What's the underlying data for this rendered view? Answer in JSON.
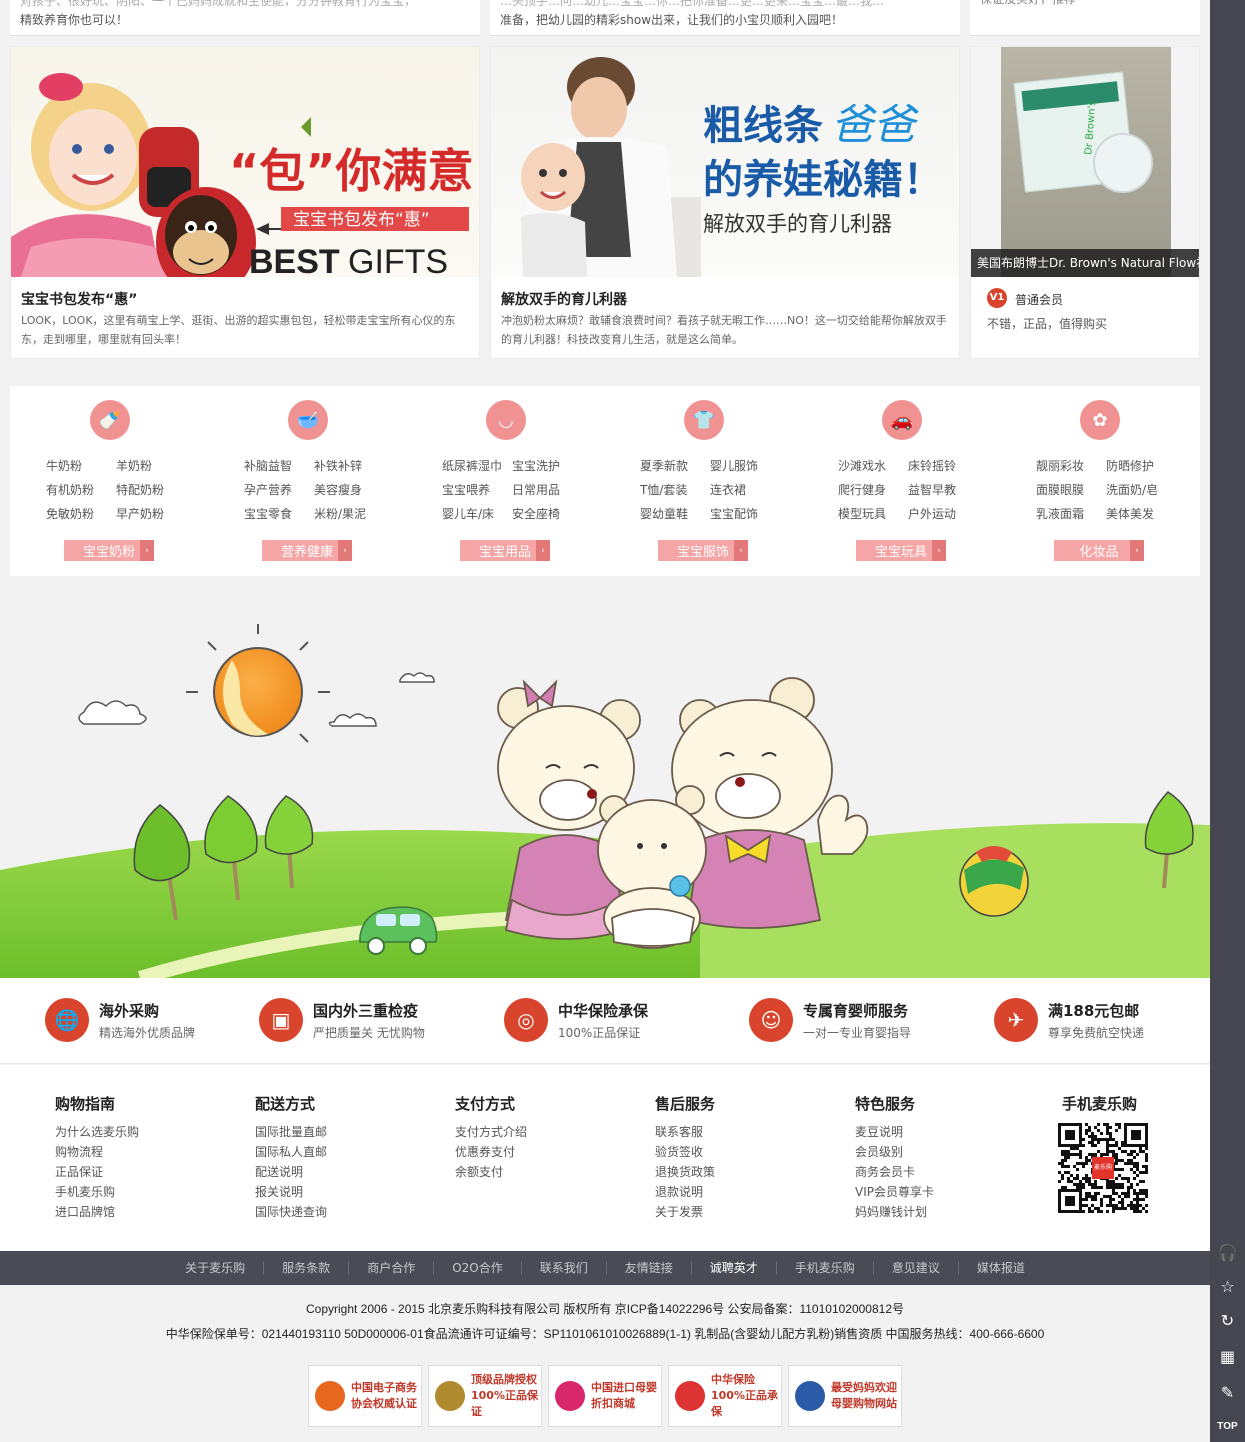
{
  "top_strip": {
    "left_text_line1": "对孩子、很好玩、阴阳、一个已妈妈成就和生使能，分分钟教育行为宝宝，",
    "left_text_line2": "精致养育你也可以！",
    "mid_text_line1": "…头顶手…问…幼儿…宝宝…你…把你准备…更…更来…宝宝…最…我…",
    "mid_text_line2": "准备，把幼儿园的精彩show出来，让我们的小宝贝顺利入园吧！",
    "right_text": "保证没买好，推荐"
  },
  "articles": [
    {
      "title": "宝宝书包发布“惠”",
      "desc": "LOOK，LOOK，这里有萌宝上学、逛街、出游的超实惠包包，轻松带走宝宝所有心仪的东东，走到哪里，哪里就有回头率！",
      "banner_big": "“包”你满意",
      "banner_tag": "宝宝书包发布“惠”",
      "banner_best": "BEST",
      "banner_gifts": "GIFTS"
    },
    {
      "title": "解放双手的育儿利器",
      "desc": "冲泡奶粉太麻烦？敢辅食浪费时间？看孩子就无暇工作……NO！这一切交给能帮你解放双手的育儿利器！科技改变育儿生活，就是这么简单。",
      "banner_l1a": "粗线条",
      "banner_l1b": "爸爸",
      "banner_l2": "的养娃秘籍！",
      "banner_sub": "解放双手的育儿利器"
    }
  ],
  "review": {
    "caption": "美国布朗博士Dr. Brown's Natural Flow初",
    "level_badge": "V1",
    "member": "普通会员",
    "comment": "不错，正品，值得购买",
    "product_box_text": "Dr Brown's"
  },
  "categories": [
    {
      "icon": "bottle-icon",
      "glyph": "🍼",
      "links": [
        "牛奶粉",
        "羊奶粉",
        "有机奶粉",
        "特配奶粉",
        "免敏奶粉",
        "早产奶粉"
      ],
      "button": "宝宝奶粉"
    },
    {
      "icon": "bowl-icon",
      "glyph": "🥣",
      "links": [
        "补脑益智",
        "补铁补锌",
        "孕产营养",
        "美容瘦身",
        "宝宝零食",
        "米粉/果泥"
      ],
      "button": "营养健康"
    },
    {
      "icon": "diaper-icon",
      "glyph": "◡",
      "links": [
        "纸尿裤湿巾",
        "宝宝洗护",
        "宝宝喂养",
        "日常用品",
        "婴儿车/床",
        "安全座椅"
      ],
      "button": "宝宝用品"
    },
    {
      "icon": "baby-clothes-icon",
      "glyph": "👕",
      "links": [
        "夏季新款",
        "婴儿服饰",
        "T恤/套装",
        "连衣裙",
        "婴幼童鞋",
        "宝宝配饰"
      ],
      "button": "宝宝服饰"
    },
    {
      "icon": "toy-car-icon",
      "glyph": "🚗",
      "links": [
        "沙滩戏水",
        "床铃摇铃",
        "爬行健身",
        "益智早教",
        "模型玩具",
        "户外运动"
      ],
      "button": "宝宝玩具"
    },
    {
      "icon": "cosmetics-icon",
      "glyph": "✿",
      "links": [
        "靓丽彩妆",
        "防晒修护",
        "面膜眼膜",
        "洗面奶/皂",
        "乳液面霜",
        "美体美发"
      ],
      "button": "化妆品"
    }
  ],
  "category_arrow": "›",
  "services": [
    {
      "icon": "globe-icon",
      "glyph": "🌐",
      "title": "海外采购",
      "desc": "精选海外优质品牌"
    },
    {
      "icon": "inspection-icon",
      "glyph": "▣",
      "title": "国内外三重检疫",
      "desc": "严把质量关 无忧购物"
    },
    {
      "icon": "insurance-icon",
      "glyph": "◎",
      "title": "中华保险承保",
      "desc": "100%正品保证"
    },
    {
      "icon": "consultant-icon",
      "glyph": "☺",
      "title": "专属育婴师服务",
      "desc": "一对一专业育婴指导"
    },
    {
      "icon": "airplane-icon",
      "glyph": "✈",
      "title": "满188元包邮",
      "desc": "尊享免费航空快递"
    }
  ],
  "footer_columns": [
    {
      "title": "购物指南",
      "links": [
        "为什么选麦乐购",
        "购物流程",
        "正品保证",
        "手机麦乐购",
        "进口品牌馆"
      ]
    },
    {
      "title": "配送方式",
      "links": [
        "国际批量直邮",
        "国际私人直邮",
        "配送说明",
        "报关说明",
        "国际快递查询"
      ]
    },
    {
      "title": "支付方式",
      "links": [
        "支付方式介绍",
        "优惠券支付",
        "余额支付"
      ]
    },
    {
      "title": "售后服务",
      "links": [
        "联系客服",
        "验货签收",
        "退换货政策",
        "退款说明",
        "关于发票"
      ]
    },
    {
      "title": "特色服务",
      "links": [
        "麦豆说明",
        "会员级别",
        "商务会员卡",
        "VIP会员尊享卡",
        "妈妈赚钱计划"
      ]
    }
  ],
  "mobile": {
    "title": "手机麦乐购",
    "qr_logo": "麦乐购"
  },
  "nav_links": [
    "关于麦乐购",
    "服务条款",
    "商户合作",
    "O2O合作",
    "联系我们",
    "友情链接",
    "诚聘英才",
    "手机麦乐购",
    "意见建议",
    "媒体报道"
  ],
  "copyright": "Copyright 2006 - 2015 北京麦乐购科技有限公司 版权所有 京ICP备14022296号 公安局备案：11010102000812号",
  "license_line": "中华保险保单号：021440193110 50D000006-01食品流通许可证编号：SP1101061010026889(1-1) 乳制品(含婴幼儿配方乳粉)销售资质 中国服务热线：400-666-6600",
  "badges": [
    {
      "icon": "ecommerce-assoc-icon",
      "color": "#e8671f",
      "line1": "中国电子商务",
      "line2": "协会权威认证"
    },
    {
      "icon": "brand-auth-icon",
      "color": "#b08a2e",
      "line1": "顶级品牌授权",
      "line2": "100%正品保证"
    },
    {
      "icon": "import-mother-baby-icon",
      "color": "#d8276b",
      "line1": "中国进口母婴",
      "line2": "折扣商城"
    },
    {
      "icon": "sino-insurance-icon",
      "color": "#d33",
      "line1": "中华保险",
      "line2": "100%正品承保"
    },
    {
      "icon": "mom-favorite-icon",
      "color": "#2a5aa8",
      "line1": "最受妈妈欢迎",
      "line2": "母婴购物网站"
    }
  ],
  "right_toolbar": [
    {
      "name": "customer-service-icon",
      "glyph": "🎧"
    },
    {
      "name": "favorite-star-icon",
      "glyph": "☆"
    },
    {
      "name": "refresh-icon",
      "glyph": "↻"
    },
    {
      "name": "qr-code-icon",
      "glyph": "▦"
    },
    {
      "name": "edit-feedback-icon",
      "glyph": "✎"
    },
    {
      "name": "back-to-top-icon",
      "glyph": "TOP"
    }
  ],
  "colors": {
    "accent_red": "#d8452c",
    "pink": "#f19292",
    "footer_nav": "#4b4b56",
    "sidebar": "#464650"
  }
}
